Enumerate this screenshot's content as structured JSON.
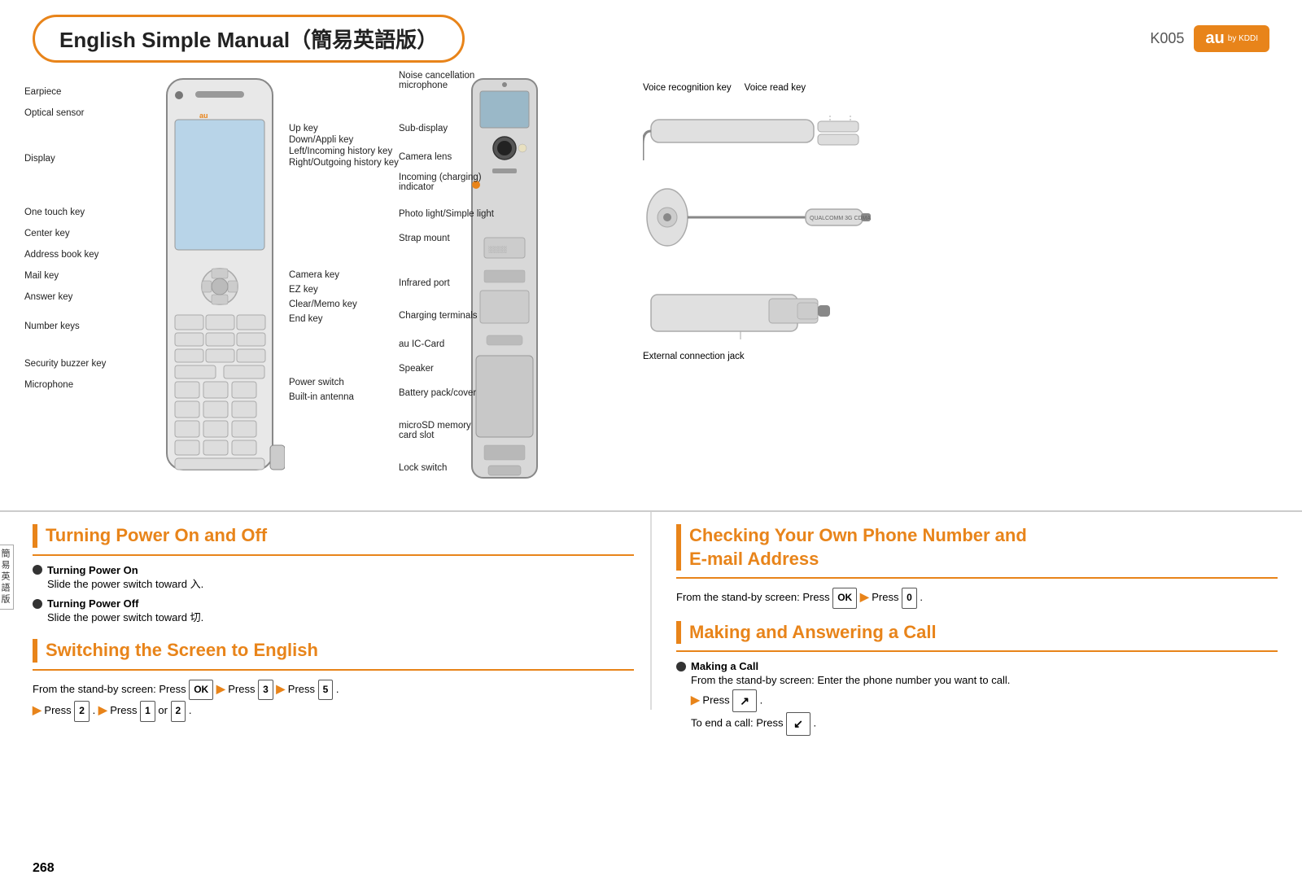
{
  "header": {
    "title": "English Simple Manual（簡易英語版）",
    "model": "K005",
    "logo": "au",
    "by_kddi": "by KDDI"
  },
  "phone_left_labels": {
    "left": [
      "Earpiece",
      "Optical sensor",
      "Display",
      "One touch key",
      "Center key",
      "Address book key",
      "Mail key",
      "Answer key",
      "Number keys",
      "Security buzzer key",
      "Microphone"
    ],
    "right_upper": [
      "Up key",
      "Down/Appli key",
      "Left/Incoming history key",
      "Right/Outgoing history key"
    ],
    "right_lower": [
      "Camera key",
      "EZ key",
      "Clear/Memo key",
      "End key",
      "Power switch",
      "Built-in antenna"
    ]
  },
  "phone_center_labels": [
    "Noise cancellation microphone",
    "Sub-display",
    "Camera lens",
    "Incoming (charging) indicator",
    "Photo light/Simple light",
    "Strap mount",
    "Infrared port",
    "Charging terminals",
    "au IC-Card",
    "Speaker",
    "Battery pack/cover",
    "microSD memory card slot",
    "Lock switch"
  ],
  "phone_right_labels": [
    "Voice recognition key",
    "Voice read key",
    "External connection jack"
  ],
  "section_power": {
    "title": "Turning Power On and Off",
    "on_title": "Turning Power On",
    "on_body": "Slide the power switch toward 入.",
    "off_title": "Turning Power Off",
    "off_body": "Slide the power switch toward 切."
  },
  "section_english": {
    "title": "Switching the Screen to English",
    "body1": "From the stand-by screen: Press",
    "key1": "OK",
    "then1": "▶Press",
    "key2": "3",
    "then2": "▶Press",
    "key3": "5",
    "then3": "▶Press",
    "key4": "2",
    "then4": "▶Press",
    "key5": "1",
    "or": "or",
    "key6": "2"
  },
  "section_phone_number": {
    "title1": "Checking Your Own Phone Number and",
    "title2": "E-mail Address",
    "body": "From the stand-by screen: Press",
    "key1": "OK",
    "then": "▶Press",
    "key2": "0"
  },
  "section_call": {
    "title": "Making and Answering a Call",
    "making_title": "Making a Call",
    "making_body1": "From the stand-by screen: Enter the phone number you want to call.",
    "making_body2": "▶Press",
    "making_key1": "↗",
    "making_body3": "To end a call: Press",
    "making_key2": "↙"
  },
  "page_number": "268",
  "side_label": "簡易英語版"
}
